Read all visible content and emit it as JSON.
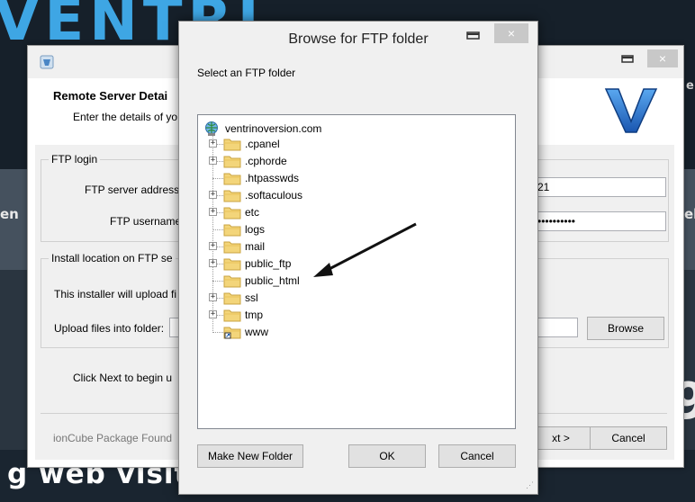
{
  "background": {
    "logo_text": "VENTRI",
    "bottom_text": "g web visit        r customer",
    "side_text_left": "en",
    "side_text_right": "el",
    "side_text_right_top": "e",
    "side_big_right": "9"
  },
  "installer": {
    "header_title": "Remote Server Detai",
    "header_subtitle": "Enter the details of yo",
    "ftp_login": {
      "legend": "FTP login",
      "server_label": "FTP server address",
      "port_value": "21",
      "username_label": "FTP username",
      "password_value": "••••••••••"
    },
    "install_location": {
      "legend": "Install location on FTP se",
      "description": "This installer will upload fi",
      "folder_label": "Upload files into folder:",
      "browse_label": "Browse"
    },
    "next_hint": "Click Next to begin u",
    "footer": "ionCube Package Found",
    "next_label": "xt >",
    "cancel_label": "Cancel"
  },
  "dialog": {
    "title": "Browse for FTP folder",
    "prompt": "Select an FTP folder",
    "root": "ventrinoversion.com",
    "folders": [
      {
        "name": ".cpanel",
        "expandable": true
      },
      {
        "name": ".cphorde",
        "expandable": true
      },
      {
        "name": ".htpasswds",
        "expandable": false
      },
      {
        "name": ".softaculous",
        "expandable": true
      },
      {
        "name": "etc",
        "expandable": true
      },
      {
        "name": "logs",
        "expandable": false
      },
      {
        "name": "mail",
        "expandable": true
      },
      {
        "name": "public_ftp",
        "expandable": true
      },
      {
        "name": "public_html",
        "expandable": false
      },
      {
        "name": "ssl",
        "expandable": true
      },
      {
        "name": "tmp",
        "expandable": true
      },
      {
        "name": "www",
        "expandable": false,
        "shortcut": true
      }
    ],
    "make_folder_label": "Make New Folder",
    "ok_label": "OK",
    "cancel_label": "Cancel",
    "close_glyph": "×"
  },
  "colors": {
    "accent_blue": "#3ea6e4",
    "folder_yellow": "#f3d57a",
    "v_logo_blue": "#1f6fd0"
  }
}
